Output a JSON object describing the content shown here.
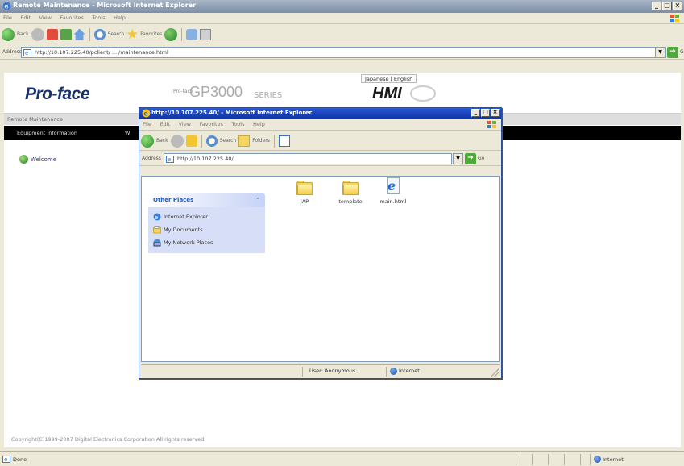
{
  "outer_window": {
    "title": "Remote Maintenance - Microsoft Internet Explorer",
    "menu": [
      "File",
      "Edit",
      "View",
      "Favorites",
      "Tools",
      "Help"
    ],
    "toolbar": {
      "back_label": "Back",
      "search_label": "Search",
      "favorites_label": "Favorites"
    },
    "address_label": "Address",
    "address_url": "http://10.107.225.40/pclient/ ... /maintenance.html",
    "go_label": "Go",
    "status_text": "Done",
    "status_zone": "Internet"
  },
  "page": {
    "top_links": "Japanese | English",
    "logo": "Pro-face",
    "series_prefix": "Pro-face",
    "series_name": "GP3000",
    "series_suffix": "SERIES",
    "hmi": "HMI",
    "remote_maintenance": "Remote Maintenance",
    "menu_equipment": "Equipment Information",
    "menu_second": "W",
    "welcome": "Welcome",
    "copyright": "Copyright(C)1999-2007 Digital Electronics Corporation All rights reserved"
  },
  "inner_window": {
    "title": "http://10.107.225.40/ - Microsoft Internet Explorer",
    "menu": [
      "File",
      "Edit",
      "View",
      "Favorites",
      "Tools",
      "Help"
    ],
    "toolbar": {
      "back_label": "Back",
      "search_label": "Search",
      "folders_label": "Folders"
    },
    "address_label": "Address",
    "address_url": "http://10.107.225.40/",
    "go_label": "Go",
    "other_places": {
      "heading": "Other Places",
      "items": [
        {
          "label": "Internet Explorer",
          "icon": "ie-icon"
        },
        {
          "label": "My Documents",
          "icon": "documents-folder-icon"
        },
        {
          "label": "My Network Places",
          "icon": "network-places-icon"
        }
      ]
    },
    "files": [
      {
        "label": "JAP",
        "icon": "folder-icon"
      },
      {
        "label": "template",
        "icon": "folder-icon"
      },
      {
        "label": "main.html",
        "icon": "ie-document-icon"
      }
    ],
    "status_text": "User: Anonymous",
    "status_zone": "Internet"
  },
  "colors": {
    "outer_title": "#8c9db3",
    "inner_title": "#1740b6",
    "logo": "#1a2f6e",
    "task_pane": "#d6dff7",
    "menu_bar": "#000000"
  }
}
